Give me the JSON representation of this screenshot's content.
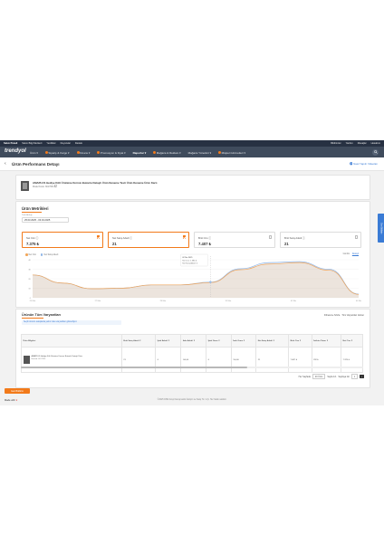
{
  "topbar": {
    "store": "Satıcı Paneli",
    "links": [
      "Satıcı Bilgi Merkezi",
      "Yenilikler",
      "Duyurular",
      "Destek"
    ],
    "right_items": [
      "Bildirimler",
      "Yardım",
      "Mesajlar",
      "Hesabım"
    ]
  },
  "nav": {
    "logo": "trendyol",
    "items": [
      {
        "label": "Ürün",
        "badge": false
      },
      {
        "label": "Sipariş & Kargo",
        "badge": true
      },
      {
        "label": "Finans",
        "badge": true
      },
      {
        "label": "Promosyon & Fiyat",
        "badge": true
      },
      {
        "label": "Raporlar",
        "badge": false,
        "active": true
      },
      {
        "label": "Mağaza & Reklam",
        "badge": true
      },
      {
        "label": "Mağaza Yönetimi",
        "badge": false
      },
      {
        "label": "Müşteri Hizmetleri",
        "badge": true
      }
    ]
  },
  "page": {
    "title": "Ürün Performans Detayı",
    "back": "‹",
    "help": "Nasıl Yapılır Videoları"
  },
  "product": {
    "name": "AMAPLUS Hediye Kitli Ürününe Kırmızı Butonlu Detaylı Ürün Deneme Testi Ürün Deneme Ürün Kartı",
    "meta": "Model Kodu: 6617954"
  },
  "metrics": {
    "title": "Ürün Metrikleri",
    "date_label": "Tarih Aralığı",
    "date_range": "25.03.2025 - 03.04.2025",
    "cards": [
      {
        "label": "Net Ciro",
        "value": "7.375 ₺",
        "selected": true
      },
      {
        "label": "Net Satış Adedi",
        "value": "21",
        "selected": true
      },
      {
        "label": "Brüt Ciro",
        "value": "7.407 ₺",
        "selected": false
      },
      {
        "label": "Brüt Satış Adedi",
        "value": "21",
        "selected": false
      }
    ],
    "legend": [
      "Net Ciro",
      "Net Satış Adedi"
    ],
    "nav_text": "Günlük",
    "nav_link": "Detaylı"
  },
  "chart_data": {
    "type": "area",
    "x": [
      "25 Mar",
      "27 Mar",
      "29 Mar",
      "31 Mar",
      "02 Nis",
      "04 Nis"
    ],
    "ylim": [
      0,
      4000
    ],
    "series": [
      {
        "name": "Net Ciro",
        "color": "#f2a65a",
        "values": [
          2400,
          1550,
          950,
          1000,
          1350,
          1350,
          1600,
          2950,
          3550,
          3700,
          2900,
          350
        ]
      },
      {
        "name": "Net Satış Adedi",
        "color": "#8fb6e8",
        "values": [
          2400,
          1550,
          950,
          1000,
          1350,
          1350,
          1650,
          3050,
          3700,
          3800,
          3000,
          380
        ]
      }
    ],
    "yticks": [
      "4K",
      "3K",
      "2K",
      "1K",
      "0"
    ],
    "tooltip": {
      "date": "02 Nis 2025",
      "rows": [
        "Net Ciro: 1.384 ₺",
        "Net Satış Adedi: 4"
      ]
    }
  },
  "variants": {
    "title": "Ürünün Tüm Varyantları",
    "action": "Filtreleme Sıfırla  ·  Tüm Varyantları Göster",
    "info": "Seçili ürünün satışlarda yalnız olan varyantları gösteriliyor.",
    "columns": [
      "Ürün Bilgileri",
      "Brüt Satış Adedi",
      "İptal Adedi",
      "İade Adedi",
      "İptal Oranı",
      "İade Oranı",
      "Net Satış Adedi",
      "Brüt Ciro",
      "İndirim Tutarı",
      "Net Ciro"
    ],
    "rows": [
      {
        "product": "AMAPLUS Hediye Kitli Ürününe Kırmızı Butonlu Detaylı Ürün",
        "barcode": "Barkod: 6617954",
        "cells": [
          "21",
          "0",
          "%0,00",
          "0",
          "%0,00",
          "21",
          "7.407 ₺",
          "232 ₺",
          "7.375 ₺"
        ]
      }
    ],
    "pager": {
      "per_page_label": "Her Sayfada",
      "per_page": "20 Ürün",
      "page_label": "Sayfa 1/1",
      "goto_label": "Sayfaya Git",
      "goto_value": "1",
      "next": "›"
    }
  },
  "feedback": "Geri Bildirim",
  "footer": {
    "heart_text": "Made with",
    "copyright": "©2025 DSM Grup Danışmanlık İletişim ve Satış Tic. A.Ş. Her hakkı saklıdır."
  },
  "sidetab": "Geri Bildirim",
  "colors": {
    "brand": "#f27a1a",
    "nav": "#3f4b5c",
    "link": "#3a7bd5"
  }
}
